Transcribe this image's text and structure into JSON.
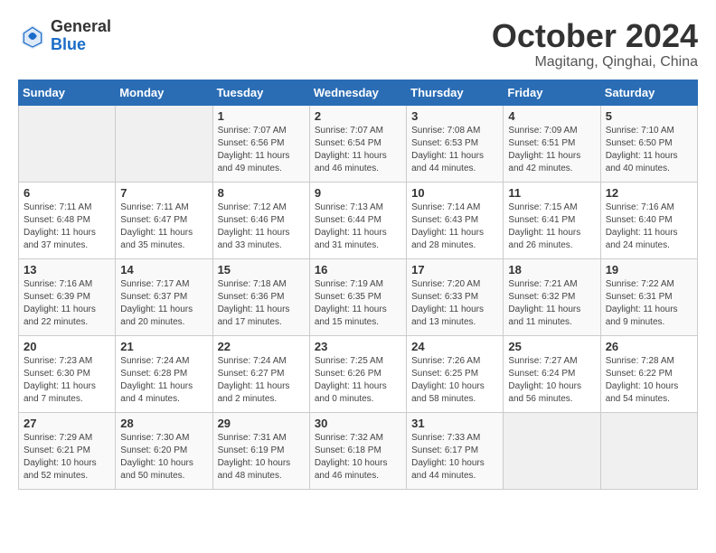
{
  "header": {
    "logo_general": "General",
    "logo_blue": "Blue",
    "title": "October 2024",
    "location": "Magitang, Qinghai, China"
  },
  "weekdays": [
    "Sunday",
    "Monday",
    "Tuesday",
    "Wednesday",
    "Thursday",
    "Friday",
    "Saturday"
  ],
  "weeks": [
    [
      {
        "day": "",
        "empty": true
      },
      {
        "day": "",
        "empty": true
      },
      {
        "day": "1",
        "sunrise": "Sunrise: 7:07 AM",
        "sunset": "Sunset: 6:56 PM",
        "daylight": "Daylight: 11 hours and 49 minutes."
      },
      {
        "day": "2",
        "sunrise": "Sunrise: 7:07 AM",
        "sunset": "Sunset: 6:54 PM",
        "daylight": "Daylight: 11 hours and 46 minutes."
      },
      {
        "day": "3",
        "sunrise": "Sunrise: 7:08 AM",
        "sunset": "Sunset: 6:53 PM",
        "daylight": "Daylight: 11 hours and 44 minutes."
      },
      {
        "day": "4",
        "sunrise": "Sunrise: 7:09 AM",
        "sunset": "Sunset: 6:51 PM",
        "daylight": "Daylight: 11 hours and 42 minutes."
      },
      {
        "day": "5",
        "sunrise": "Sunrise: 7:10 AM",
        "sunset": "Sunset: 6:50 PM",
        "daylight": "Daylight: 11 hours and 40 minutes."
      }
    ],
    [
      {
        "day": "6",
        "sunrise": "Sunrise: 7:11 AM",
        "sunset": "Sunset: 6:48 PM",
        "daylight": "Daylight: 11 hours and 37 minutes."
      },
      {
        "day": "7",
        "sunrise": "Sunrise: 7:11 AM",
        "sunset": "Sunset: 6:47 PM",
        "daylight": "Daylight: 11 hours and 35 minutes."
      },
      {
        "day": "8",
        "sunrise": "Sunrise: 7:12 AM",
        "sunset": "Sunset: 6:46 PM",
        "daylight": "Daylight: 11 hours and 33 minutes."
      },
      {
        "day": "9",
        "sunrise": "Sunrise: 7:13 AM",
        "sunset": "Sunset: 6:44 PM",
        "daylight": "Daylight: 11 hours and 31 minutes."
      },
      {
        "day": "10",
        "sunrise": "Sunrise: 7:14 AM",
        "sunset": "Sunset: 6:43 PM",
        "daylight": "Daylight: 11 hours and 28 minutes."
      },
      {
        "day": "11",
        "sunrise": "Sunrise: 7:15 AM",
        "sunset": "Sunset: 6:41 PM",
        "daylight": "Daylight: 11 hours and 26 minutes."
      },
      {
        "day": "12",
        "sunrise": "Sunrise: 7:16 AM",
        "sunset": "Sunset: 6:40 PM",
        "daylight": "Daylight: 11 hours and 24 minutes."
      }
    ],
    [
      {
        "day": "13",
        "sunrise": "Sunrise: 7:16 AM",
        "sunset": "Sunset: 6:39 PM",
        "daylight": "Daylight: 11 hours and 22 minutes."
      },
      {
        "day": "14",
        "sunrise": "Sunrise: 7:17 AM",
        "sunset": "Sunset: 6:37 PM",
        "daylight": "Daylight: 11 hours and 20 minutes."
      },
      {
        "day": "15",
        "sunrise": "Sunrise: 7:18 AM",
        "sunset": "Sunset: 6:36 PM",
        "daylight": "Daylight: 11 hours and 17 minutes."
      },
      {
        "day": "16",
        "sunrise": "Sunrise: 7:19 AM",
        "sunset": "Sunset: 6:35 PM",
        "daylight": "Daylight: 11 hours and 15 minutes."
      },
      {
        "day": "17",
        "sunrise": "Sunrise: 7:20 AM",
        "sunset": "Sunset: 6:33 PM",
        "daylight": "Daylight: 11 hours and 13 minutes."
      },
      {
        "day": "18",
        "sunrise": "Sunrise: 7:21 AM",
        "sunset": "Sunset: 6:32 PM",
        "daylight": "Daylight: 11 hours and 11 minutes."
      },
      {
        "day": "19",
        "sunrise": "Sunrise: 7:22 AM",
        "sunset": "Sunset: 6:31 PM",
        "daylight": "Daylight: 11 hours and 9 minutes."
      }
    ],
    [
      {
        "day": "20",
        "sunrise": "Sunrise: 7:23 AM",
        "sunset": "Sunset: 6:30 PM",
        "daylight": "Daylight: 11 hours and 7 minutes."
      },
      {
        "day": "21",
        "sunrise": "Sunrise: 7:24 AM",
        "sunset": "Sunset: 6:28 PM",
        "daylight": "Daylight: 11 hours and 4 minutes."
      },
      {
        "day": "22",
        "sunrise": "Sunrise: 7:24 AM",
        "sunset": "Sunset: 6:27 PM",
        "daylight": "Daylight: 11 hours and 2 minutes."
      },
      {
        "day": "23",
        "sunrise": "Sunrise: 7:25 AM",
        "sunset": "Sunset: 6:26 PM",
        "daylight": "Daylight: 11 hours and 0 minutes."
      },
      {
        "day": "24",
        "sunrise": "Sunrise: 7:26 AM",
        "sunset": "Sunset: 6:25 PM",
        "daylight": "Daylight: 10 hours and 58 minutes."
      },
      {
        "day": "25",
        "sunrise": "Sunrise: 7:27 AM",
        "sunset": "Sunset: 6:24 PM",
        "daylight": "Daylight: 10 hours and 56 minutes."
      },
      {
        "day": "26",
        "sunrise": "Sunrise: 7:28 AM",
        "sunset": "Sunset: 6:22 PM",
        "daylight": "Daylight: 10 hours and 54 minutes."
      }
    ],
    [
      {
        "day": "27",
        "sunrise": "Sunrise: 7:29 AM",
        "sunset": "Sunset: 6:21 PM",
        "daylight": "Daylight: 10 hours and 52 minutes."
      },
      {
        "day": "28",
        "sunrise": "Sunrise: 7:30 AM",
        "sunset": "Sunset: 6:20 PM",
        "daylight": "Daylight: 10 hours and 50 minutes."
      },
      {
        "day": "29",
        "sunrise": "Sunrise: 7:31 AM",
        "sunset": "Sunset: 6:19 PM",
        "daylight": "Daylight: 10 hours and 48 minutes."
      },
      {
        "day": "30",
        "sunrise": "Sunrise: 7:32 AM",
        "sunset": "Sunset: 6:18 PM",
        "daylight": "Daylight: 10 hours and 46 minutes."
      },
      {
        "day": "31",
        "sunrise": "Sunrise: 7:33 AM",
        "sunset": "Sunset: 6:17 PM",
        "daylight": "Daylight: 10 hours and 44 minutes."
      },
      {
        "day": "",
        "empty": true
      },
      {
        "day": "",
        "empty": true
      }
    ]
  ]
}
